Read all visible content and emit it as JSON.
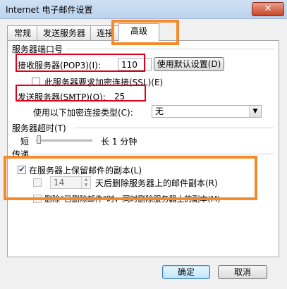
{
  "window": {
    "title": "Internet 电子邮件设置",
    "close_glyph": "✕"
  },
  "tabs": [
    {
      "label": "常规"
    },
    {
      "label": "发送服务器"
    },
    {
      "label": "连接"
    },
    {
      "label": "高级",
      "active": true
    }
  ],
  "ports": {
    "section_title": "服务器端口号",
    "incoming_label": "接收服务器(POP3)(I):",
    "incoming_value": "110",
    "default_button": "使用默认设置(D)",
    "ssl_label": "此服务器要求加密连接(SSL)(E)",
    "ssl_checked": false,
    "outgoing_label": "发送服务器(SMTP)(O):",
    "outgoing_value": "25",
    "encryption_label": "使用以下加密连接类型(C):",
    "encryption_value": "无"
  },
  "timeout": {
    "section_title": "服务器超时(T)",
    "short_label": "短",
    "long_label": "长 1 分钟",
    "level": 0.05
  },
  "delivery": {
    "section_title": "传递",
    "leave_copy_label": "在服务器上保留邮件的副本(L)",
    "leave_copy_checked": true,
    "remove_after_days_value": "14",
    "remove_after_label": "天后删除服务器上的邮件副本(R)",
    "remove_when_deleted_label": "删除“已删除邮件”时，同时删除服务器上的副本(M)"
  },
  "footer": {
    "ok_button": "确定",
    "cancel_button": "取消"
  },
  "highlight_colors": {
    "red": "#e0001b",
    "orange": "#f58a2a"
  }
}
